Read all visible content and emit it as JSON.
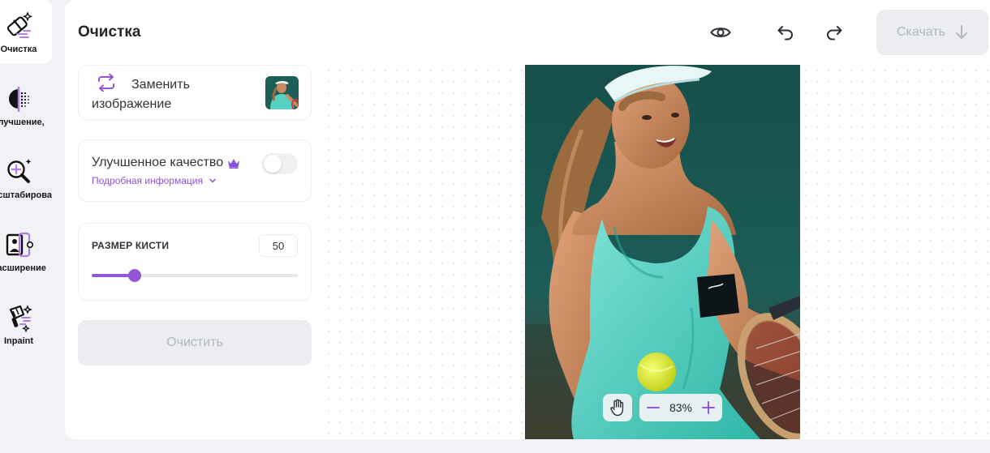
{
  "sidebar": {
    "items": [
      {
        "label": "Очистка",
        "icon": "eraser-sparkle-icon",
        "active": true
      },
      {
        "label": "Улучшение,",
        "icon": "enhance-halftone-icon",
        "active": false
      },
      {
        "label": "Масштабирование",
        "icon": "magnify-plus-icon",
        "active": false
      },
      {
        "label": "Расширение",
        "icon": "expand-image-icon",
        "active": false
      },
      {
        "label": "Inpaint",
        "icon": "brush-sparkle-icon",
        "active": false
      }
    ]
  },
  "header": {
    "title": "Очистка",
    "download_label": "Скачать",
    "icons": [
      "eye-icon",
      "undo-icon",
      "redo-icon",
      "arrow-down-icon"
    ]
  },
  "panel": {
    "replace": {
      "line1": "Заменить",
      "line2": "изображение",
      "icon": "swap-arrows-icon"
    },
    "quality": {
      "title": "Улучшенное качество",
      "link": "Подробная информация",
      "enabled": false,
      "icon": "crown-icon"
    },
    "brush": {
      "title": "РАЗМЕР КИСТИ",
      "value": "50",
      "fraction": 0.21
    },
    "clean_label": "Очистить"
  },
  "canvas": {
    "zoom": "83%",
    "icons": [
      "hand-icon",
      "minus-icon",
      "plus-icon"
    ]
  },
  "colors": {
    "accent": "#9456d8",
    "disabled_bg": "#ebedf0",
    "disabled_text": "#b3b7bf",
    "app_bg": "#f1f2f5"
  }
}
